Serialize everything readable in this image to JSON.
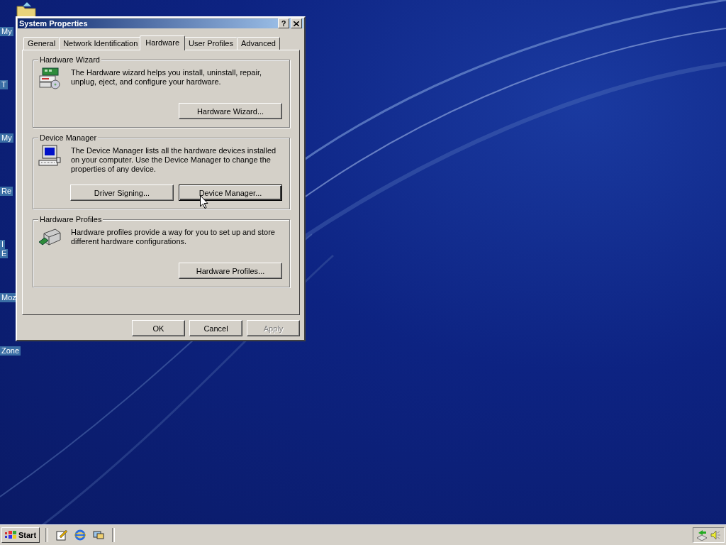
{
  "desktop": {
    "icons": [
      {
        "lines": [
          "My"
        ]
      },
      {
        "lines": [
          "T"
        ]
      },
      {
        "lines": [
          "My"
        ]
      },
      {
        "lines": [
          "Re"
        ]
      },
      {
        "lines": [
          "I",
          "E"
        ]
      },
      {
        "lines": [
          "Moz"
        ]
      },
      {
        "lines": [
          "Zone"
        ]
      }
    ]
  },
  "window": {
    "title": "System Properties",
    "help_button": "?",
    "tabs": [
      {
        "label": "General",
        "selected": false
      },
      {
        "label": "Network Identification",
        "selected": false
      },
      {
        "label": "Hardware",
        "selected": true
      },
      {
        "label": "User Profiles",
        "selected": false
      },
      {
        "label": "Advanced",
        "selected": false
      }
    ],
    "groups": [
      {
        "kind": "wizard",
        "title": "Hardware Wizard",
        "description": "The Hardware wizard helps you install, uninstall, repair, unplug, eject, and configure your hardware.",
        "buttons": [
          {
            "label": "Hardware Wizard...",
            "focused": false
          }
        ]
      },
      {
        "kind": "devices",
        "title": "Device Manager",
        "description": "The Device Manager lists all the hardware devices installed on your computer. Use the Device Manager to change the properties of any device.",
        "buttons": [
          {
            "label": "Driver Signing...",
            "focused": false
          },
          {
            "label": "Device Manager...",
            "focused": true
          }
        ]
      },
      {
        "kind": "profiles",
        "title": "Hardware Profiles",
        "description": "Hardware profiles provide a way for you to set up and store different hardware configurations.",
        "buttons": [
          {
            "label": "Hardware Profiles...",
            "focused": false
          }
        ]
      }
    ],
    "footer_buttons": [
      {
        "label": "OK",
        "disabled": false
      },
      {
        "label": "Cancel",
        "disabled": false
      },
      {
        "label": "Apply",
        "disabled": true
      }
    ]
  },
  "taskbar": {
    "start_label": "Start"
  }
}
